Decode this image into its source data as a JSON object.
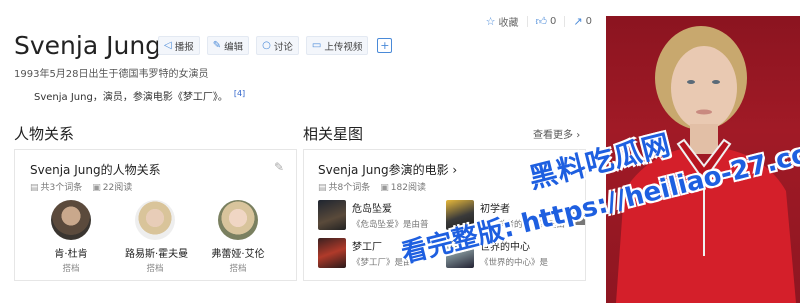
{
  "header": {
    "title": "Svenja Jung",
    "tools": [
      {
        "label": "播报",
        "icon": "speaker-icon"
      },
      {
        "label": "编辑",
        "icon": "pencil-icon"
      },
      {
        "label": "讨论",
        "icon": "comment-icon"
      },
      {
        "label": "上传视频",
        "icon": "video-icon"
      }
    ],
    "plus": "+",
    "actions": {
      "favorite": "收藏",
      "like_count": "0",
      "share_count": "0"
    }
  },
  "subtitle": "1993年5月28日出生于德国韦罗特的女演员",
  "summary": {
    "text": "Svenja Jung，演员，参演电影《梦工厂》。",
    "ref": "[4]"
  },
  "relations": {
    "heading": "人物关系",
    "card_title": "Svenja Jung的人物关系",
    "entries": "共3个词条",
    "reads": "22阅读",
    "people": [
      {
        "name": "肯·杜肯",
        "role": "搭档"
      },
      {
        "name": "路易斯·霍夫曼",
        "role": "搭档"
      },
      {
        "name": "弗蕾娅·艾伦",
        "role": "搭档"
      }
    ]
  },
  "stars": {
    "heading": "相关星图",
    "more": "查看更多",
    "card_title": "Svenja Jung参演的电影",
    "entries": "共8个词条",
    "reads": "182阅读",
    "movies": [
      {
        "title": "危岛坠爱",
        "desc": "《危岛坠爱》是由普"
      },
      {
        "title": "初学者",
        "desc": "《初学者的死亡》是由"
      },
      {
        "title": "梦工厂",
        "desc": "《梦工厂》是由"
      },
      {
        "title": "世界的中心",
        "desc": "《世界的中心》是"
      }
    ]
  },
  "watermark": {
    "line1": "黑料吃瓜网",
    "line2": "看完整版: https://heiliao-27.com"
  },
  "colors": {
    "link": "#4a8ad8",
    "photo_bg": "#9a1824",
    "watermark": "#1e5fe0"
  }
}
